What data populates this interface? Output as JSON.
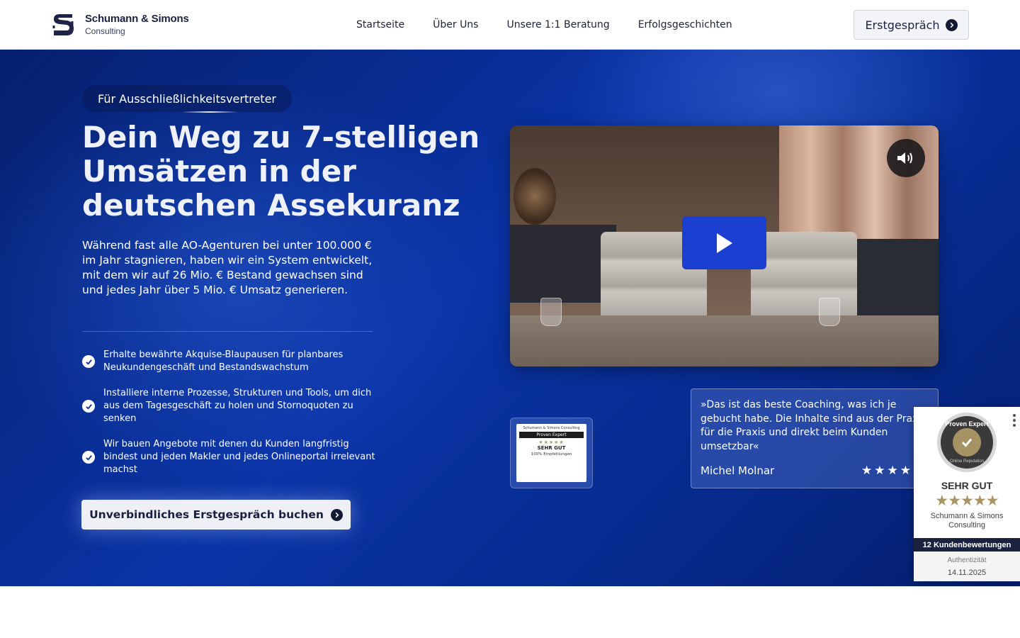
{
  "header": {
    "logo_name": "Schumann & Simons",
    "logo_sub": "Consulting",
    "nav": [
      "Startseite",
      "Über Uns",
      "Unsere 1:1 Beratung",
      "Erfolgsgeschichten"
    ],
    "cta_label": "Erstgespräch"
  },
  "hero": {
    "badge": "Für Ausschließlichkeitsvertreter",
    "title": "Dein Weg zu 7-stelligen Umsätzen in der deutschen Assekuranz",
    "description": "Während fast alle AO-Agenturen bei unter 100.000 €  im Jahr stagnieren, haben wir ein System entwickelt, mit dem wir auf 26 Mio. € Bestand gewachsen sind und jedes Jahr über 5 Mio. € Umsatz generieren.",
    "benefits": [
      "Erhalte bewährte Akquise-Blaupausen für planbares Neukundengeschäft und Bestandswachstum",
      "Installiere interne Prozesse, Strukturen und Tools, um dich aus dem Tagesgeschäft zu holen und Stornoquoten zu senken",
      "Wir bauen Angebote mit denen du Kunden langfristig bindest und jeden Makler und jedes Onlineportal irrelevant machst"
    ],
    "cta_label": "Unverbindliches Erstgespräch buchen"
  },
  "video": {
    "play_icon": "play-icon",
    "sound_icon": "volume-icon"
  },
  "proven_small": {
    "header": "Schumann & Simons Consulting",
    "bar": "Proven Expert",
    "rating": "SEHR GUT",
    "recommendation": "100% Empfehlungen"
  },
  "testimonial": {
    "quote": "»Das ist das beste Coaching, was ich je gebucht habe. Die Inhalte sind aus der Praxis für die Praxis und direkt beim Kunden umsetzbar«",
    "author": "Michel Molnar",
    "stars": "★★★★"
  },
  "proven_widget": {
    "seal_top": "Proven Expert",
    "seal_bottom": "Online Reputation",
    "rating": "SEHR GUT",
    "stars": "★★★★★",
    "company": "Schumann & Simons Consulting",
    "count": "12 Kundenbewertungen",
    "authenticity": "Authentizität",
    "date": "14.11.2025"
  }
}
